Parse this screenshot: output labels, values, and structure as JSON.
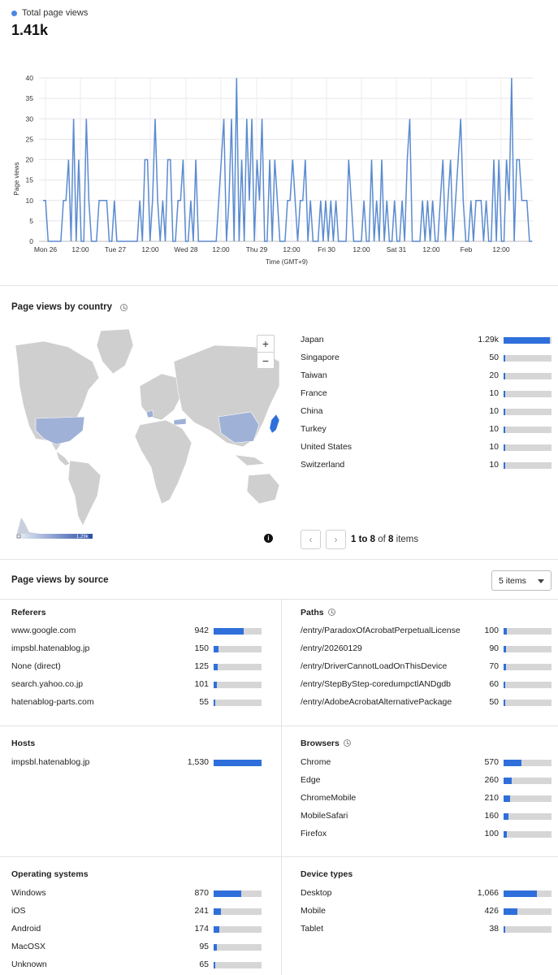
{
  "header": {
    "legend_label": "Total page views",
    "legend_color": "#4a88e0",
    "total": "1.41k"
  },
  "chart_data": {
    "type": "line",
    "title": "",
    "xlabel": "Time (GMT+9)",
    "ylabel": "Page views",
    "ylim": [
      0,
      40
    ],
    "yticks": [
      0,
      5,
      10,
      15,
      20,
      25,
      30,
      35,
      40
    ],
    "grid": true,
    "color": "#5b8bd0",
    "x_tick_labels": [
      "Mon 26",
      "12:00",
      "Tue 27",
      "12:00",
      "Wed 28",
      "12:00",
      "Thu 29",
      "12:00",
      "Fri 30",
      "12:00",
      "Sat 31",
      "12:00",
      "Feb",
      "12:00"
    ],
    "x_labels_note": "hourly points from Mon 26 00:00 to Feb 1 ~21:00",
    "series": [
      {
        "values": [
          10,
          10,
          0,
          0,
          0,
          0,
          0,
          0,
          10,
          10,
          20,
          0,
          30,
          0,
          20,
          0,
          0,
          30,
          10,
          0,
          0,
          0,
          10,
          10,
          10,
          10,
          0,
          0,
          10,
          0,
          0,
          0,
          0,
          0,
          0,
          0,
          0,
          0,
          10,
          0,
          20,
          20,
          0,
          10,
          30,
          10,
          0,
          10,
          0,
          20,
          20,
          0,
          0,
          10,
          10,
          20,
          0,
          0,
          10,
          0,
          20,
          0,
          0,
          0,
          0,
          0,
          0,
          0,
          0,
          10,
          20,
          30,
          0,
          10,
          30,
          0,
          40,
          0,
          20,
          0,
          30,
          10,
          30,
          0,
          20,
          10,
          30,
          0,
          0,
          20,
          0,
          20,
          10,
          0,
          0,
          0,
          10,
          10,
          20,
          10,
          0,
          10,
          10,
          20,
          0,
          10,
          0,
          0,
          0,
          10,
          0,
          10,
          0,
          10,
          0,
          10,
          0,
          0,
          0,
          0,
          20,
          10,
          0,
          0,
          0,
          0,
          10,
          0,
          0,
          20,
          0,
          10,
          0,
          20,
          0,
          10,
          0,
          0,
          10,
          0,
          0,
          10,
          0,
          20,
          30,
          0,
          0,
          0,
          0,
          10,
          0,
          10,
          0,
          10,
          0,
          0,
          10,
          20,
          0,
          10,
          20,
          0,
          10,
          20,
          30,
          10,
          0,
          0,
          10,
          0,
          10,
          10,
          10,
          0,
          10,
          0,
          0,
          20,
          0,
          20,
          0,
          0,
          20,
          10,
          40,
          0,
          20,
          20,
          10,
          10,
          10,
          0,
          0
        ]
      }
    ]
  },
  "country": {
    "title": "Page views by country",
    "items": [
      {
        "label": "Japan",
        "value": "1.29k",
        "fraction": 0.96
      },
      {
        "label": "Singapore",
        "value": "50",
        "fraction": 0.037
      },
      {
        "label": "Taiwan",
        "value": "20",
        "fraction": 0.015
      },
      {
        "label": "France",
        "value": "10",
        "fraction": 0.008
      },
      {
        "label": "China",
        "value": "10",
        "fraction": 0.008
      },
      {
        "label": "Turkey",
        "value": "10",
        "fraction": 0.008
      },
      {
        "label": "United States",
        "value": "10",
        "fraction": 0.008
      },
      {
        "label": "Switzerland",
        "value": "10",
        "fraction": 0.008
      }
    ],
    "map_legend_max": "1.29k",
    "pager": {
      "prev": "‹",
      "next": "›",
      "from": "1 to 8",
      "of_label": "of",
      "total": "8",
      "items_label": "items"
    }
  },
  "source": {
    "title": "Page views by source",
    "select_value": "5 items",
    "referers": {
      "title": "Referers",
      "items": [
        {
          "label": "www.google.com",
          "value": "942",
          "fraction": 0.62
        },
        {
          "label": "impsbl.hatenablog.jp",
          "value": "150",
          "fraction": 0.1
        },
        {
          "label": "None (direct)",
          "value": "125",
          "fraction": 0.08
        },
        {
          "label": "search.yahoo.co.jp",
          "value": "101",
          "fraction": 0.066
        },
        {
          "label": "hatenablog-parts.com",
          "value": "55",
          "fraction": 0.036
        }
      ]
    },
    "paths": {
      "title": "Paths",
      "items": [
        {
          "label": "/entry/ParadoxOfAcrobatPerpetualLicense",
          "value": "100",
          "fraction": 0.065
        },
        {
          "label": "/entry/20260129",
          "value": "90",
          "fraction": 0.059
        },
        {
          "label": "/entry/DriverCannotLoadOnThisDevice",
          "value": "70",
          "fraction": 0.046
        },
        {
          "label": "/entry/StepByStep-coredumpctlANDgdb",
          "value": "60",
          "fraction": 0.04
        },
        {
          "label": "/entry/AdobeAcrobatAlternativePackage",
          "value": "50",
          "fraction": 0.033
        }
      ]
    },
    "hosts": {
      "title": "Hosts",
      "items": [
        {
          "label": "impsbl.hatenablog.jp",
          "value": "1,530",
          "fraction": 1.0
        }
      ]
    },
    "browsers": {
      "title": "Browsers",
      "items": [
        {
          "label": "Chrome",
          "value": "570",
          "fraction": 0.37
        },
        {
          "label": "Edge",
          "value": "260",
          "fraction": 0.17
        },
        {
          "label": "ChromeMobile",
          "value": "210",
          "fraction": 0.137
        },
        {
          "label": "MobileSafari",
          "value": "160",
          "fraction": 0.105
        },
        {
          "label": "Firefox",
          "value": "100",
          "fraction": 0.065
        }
      ]
    },
    "os": {
      "title": "Operating systems",
      "items": [
        {
          "label": "Windows",
          "value": "870",
          "fraction": 0.57
        },
        {
          "label": "iOS",
          "value": "241",
          "fraction": 0.157
        },
        {
          "label": "Android",
          "value": "174",
          "fraction": 0.114
        },
        {
          "label": "MacOSX",
          "value": "95",
          "fraction": 0.062
        },
        {
          "label": "Unknown",
          "value": "65",
          "fraction": 0.042
        }
      ]
    },
    "devices": {
      "title": "Device types",
      "items": [
        {
          "label": "Desktop",
          "value": "1,066",
          "fraction": 0.7
        },
        {
          "label": "Mobile",
          "value": "426",
          "fraction": 0.28
        },
        {
          "label": "Tablet",
          "value": "38",
          "fraction": 0.025
        }
      ]
    }
  }
}
